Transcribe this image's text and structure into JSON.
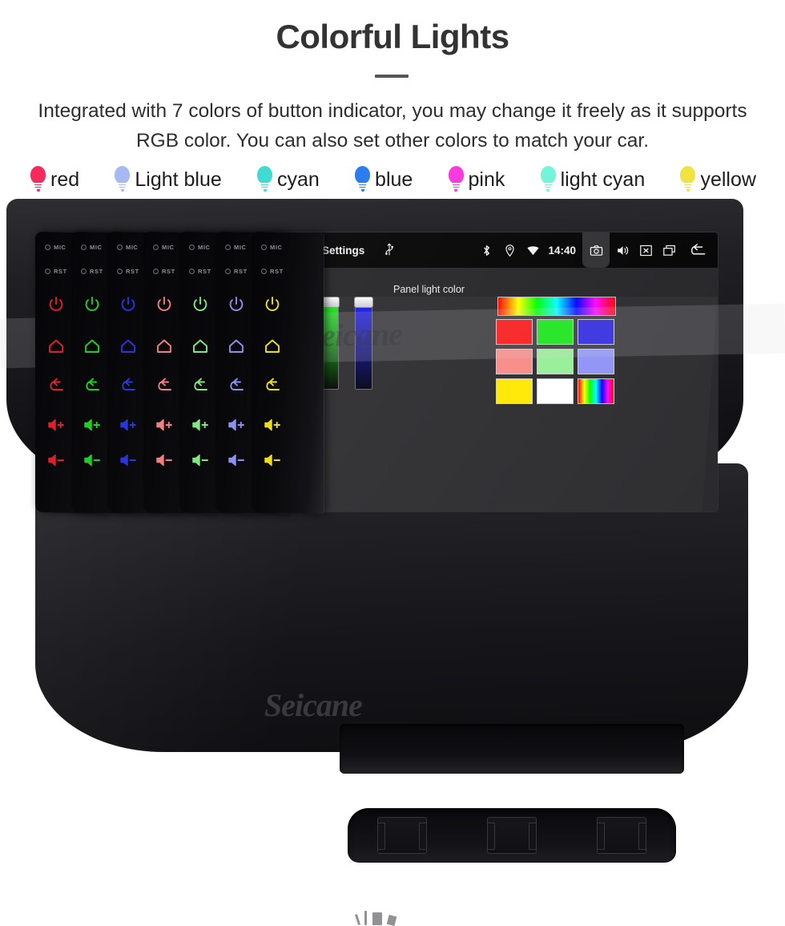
{
  "header": {
    "title": "Colorful Lights",
    "subtitle": "Integrated with 7 colors of button indicator, you may change it freely as it supports RGB color. You can also set other colors to match your car."
  },
  "legend": {
    "items": [
      {
        "label": "red",
        "color": "#f72a5e"
      },
      {
        "label": "Light blue",
        "color": "#a7b9f3"
      },
      {
        "label": "cyan",
        "color": "#3edcd3"
      },
      {
        "label": "blue",
        "color": "#2b7ef0"
      },
      {
        "label": "pink",
        "color": "#f93ae0"
      },
      {
        "label": "light cyan",
        "color": "#74f4d8"
      },
      {
        "label": "yellow",
        "color": "#f0e240"
      }
    ]
  },
  "panels": {
    "mic_label": "MIC",
    "rst_label": "RST",
    "buttons": [
      "power-icon",
      "home-icon",
      "back-icon",
      "volume-up-icon",
      "volume-down-icon"
    ],
    "colors": [
      "#e01f2a",
      "#1fd11f",
      "#2a34e0",
      "#f07f82",
      "#7fe87f",
      "#8c90ee",
      "#ece014"
    ]
  },
  "screen": {
    "status_bar": {
      "home_icon": "home-icon",
      "title": "Settings",
      "usb_icon": "usb-icon",
      "bluetooth_icon": "bluetooth-icon",
      "location_icon": "location-pin-icon",
      "wifi_icon": "wifi-icon",
      "clock": "14:40",
      "camera_icon": "camera-icon",
      "volume_icon": "speaker-icon",
      "close_icon": "close-box-icon",
      "recents_icon": "recents-icon",
      "back_icon": "back-arrow-icon"
    },
    "toolbar": {
      "back_icon": "back-arrow-icon"
    },
    "dialog": {
      "title": "Panel light color",
      "sliders": [
        {
          "name": "red-slider",
          "top_color": "#ff1a1a",
          "bottom_color": "#050000",
          "value_pct": 100
        },
        {
          "name": "green-slider",
          "top_color": "#19ff19",
          "bottom_color": "#000500",
          "value_pct": 100
        },
        {
          "name": "blue-slider",
          "top_color": "#1a1aff",
          "bottom_color": "#000012",
          "value_pct": 100
        }
      ],
      "hue_bar": "hue-gradient-bar",
      "swatches": [
        {
          "name": "swatch-red",
          "color": "#ff0000"
        },
        {
          "name": "swatch-green",
          "color": "#00e800"
        },
        {
          "name": "swatch-blue",
          "color": "#1a15e0"
        },
        {
          "name": "swatch-salmon",
          "color": "#f98a85"
        },
        {
          "name": "swatch-light-green",
          "color": "#96ef96"
        },
        {
          "name": "swatch-periwinkle",
          "color": "#8e93f6"
        },
        {
          "name": "swatch-yellow",
          "color": "#ffe800"
        },
        {
          "name": "swatch-white",
          "color": "#ffffff"
        },
        {
          "name": "swatch-rainbow",
          "color": "rainbow"
        }
      ]
    }
  },
  "watermark": {
    "brand": "Seicane",
    "brand_bottom": "Seicane"
  }
}
